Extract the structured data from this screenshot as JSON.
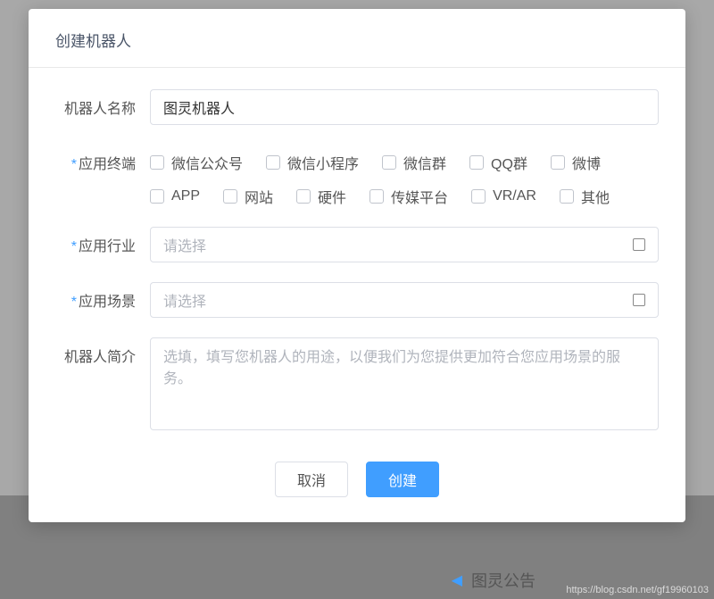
{
  "modal": {
    "title": "创建机器人",
    "name_label": "机器人名称",
    "name_value": "图灵机器人",
    "terminal_label": "应用终端",
    "terminals": [
      "微信公众号",
      "微信小程序",
      "微信群",
      "QQ群",
      "微博",
      "APP",
      "网站",
      "硬件",
      "传媒平台",
      "VR/AR",
      "其他"
    ],
    "industry_label": "应用行业",
    "industry_placeholder": "请选择",
    "scene_label": "应用场景",
    "scene_placeholder": "请选择",
    "intro_label": "机器人简介",
    "intro_placeholder": "选填，填写您机器人的用途，以便我们为您提供更加符合您应用场景的服务。",
    "cancel_label": "取消",
    "submit_label": "创建"
  },
  "background": {
    "announcement_label": "图灵公告",
    "watermark": "https://blog.csdn.net/gf19960103"
  }
}
